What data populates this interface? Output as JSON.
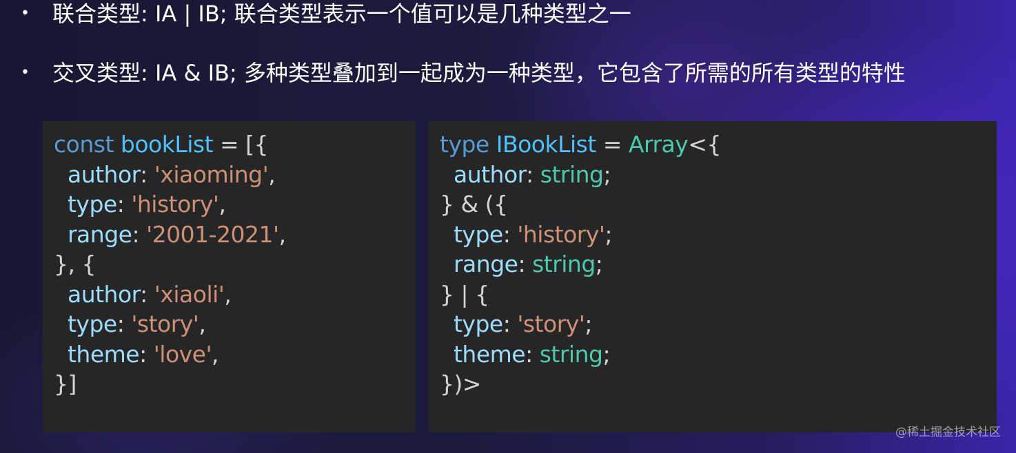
{
  "bullets": [
    "联合类型: IA | IB; 联合类型表示一个值可以是几种类型之一",
    "交叉类型: IA & IB; 多种类型叠加到一起成为一种类型，它包含了所需的所有类型的特性"
  ],
  "bullet_symbol": "•",
  "left_code": {
    "lines": [
      [
        {
          "t": "const",
          "c": "kw"
        },
        {
          "t": " "
        },
        {
          "t": "bookList",
          "c": "var"
        },
        {
          "t": " = [{"
        }
      ],
      [
        {
          "t": "  "
        },
        {
          "t": "author",
          "c": "prop"
        },
        {
          "t": ": "
        },
        {
          "t": "'xiaoming'",
          "c": "str"
        },
        {
          "t": ","
        }
      ],
      [
        {
          "t": "  "
        },
        {
          "t": "type",
          "c": "prop"
        },
        {
          "t": ": "
        },
        {
          "t": "'history'",
          "c": "str"
        },
        {
          "t": ","
        }
      ],
      [
        {
          "t": "  "
        },
        {
          "t": "range",
          "c": "prop"
        },
        {
          "t": ": "
        },
        {
          "t": "'2001-2021'",
          "c": "str"
        },
        {
          "t": ","
        }
      ],
      [
        {
          "t": "}, {"
        }
      ],
      [
        {
          "t": "  "
        },
        {
          "t": "author",
          "c": "prop"
        },
        {
          "t": ": "
        },
        {
          "t": "'xiaoli'",
          "c": "str"
        },
        {
          "t": ","
        }
      ],
      [
        {
          "t": "  "
        },
        {
          "t": "type",
          "c": "prop"
        },
        {
          "t": ": "
        },
        {
          "t": "'story'",
          "c": "str"
        },
        {
          "t": ","
        }
      ],
      [
        {
          "t": "  "
        },
        {
          "t": "theme",
          "c": "prop"
        },
        {
          "t": ": "
        },
        {
          "t": "'love'",
          "c": "str"
        },
        {
          "t": ","
        }
      ],
      [
        {
          "t": "}]"
        }
      ]
    ]
  },
  "right_code": {
    "lines": [
      [
        {
          "t": "type",
          "c": "kw"
        },
        {
          "t": " "
        },
        {
          "t": "IBookList",
          "c": "var"
        },
        {
          "t": " = "
        },
        {
          "t": "Array",
          "c": "typ"
        },
        {
          "t": "<{"
        }
      ],
      [
        {
          "t": "  "
        },
        {
          "t": "author",
          "c": "prop"
        },
        {
          "t": ": "
        },
        {
          "t": "string",
          "c": "typ"
        },
        {
          "t": ";"
        }
      ],
      [
        {
          "t": "} & ({"
        }
      ],
      [
        {
          "t": "  "
        },
        {
          "t": "type",
          "c": "prop"
        },
        {
          "t": ": "
        },
        {
          "t": "'history'",
          "c": "str"
        },
        {
          "t": ";"
        }
      ],
      [
        {
          "t": "  "
        },
        {
          "t": "range",
          "c": "prop"
        },
        {
          "t": ": "
        },
        {
          "t": "string",
          "c": "typ"
        },
        {
          "t": ";"
        }
      ],
      [
        {
          "t": "} | {"
        }
      ],
      [
        {
          "t": "  "
        },
        {
          "t": "type",
          "c": "prop"
        },
        {
          "t": ": "
        },
        {
          "t": "'story'",
          "c": "str"
        },
        {
          "t": ";"
        }
      ],
      [
        {
          "t": "  "
        },
        {
          "t": "theme",
          "c": "prop"
        },
        {
          "t": ": "
        },
        {
          "t": "string",
          "c": "typ"
        },
        {
          "t": ";"
        }
      ],
      [
        {
          "t": "})>"
        }
      ]
    ]
  },
  "watermark": "@稀土掘金技术社区",
  "colors": {
    "keyword": "#569cd6",
    "variable": "#4fc1ff",
    "property": "#9cdcfe",
    "string": "#ce9178",
    "type": "#4ec9b0",
    "punctuation": "#d4d4d4",
    "panel_bg": "#262626"
  }
}
